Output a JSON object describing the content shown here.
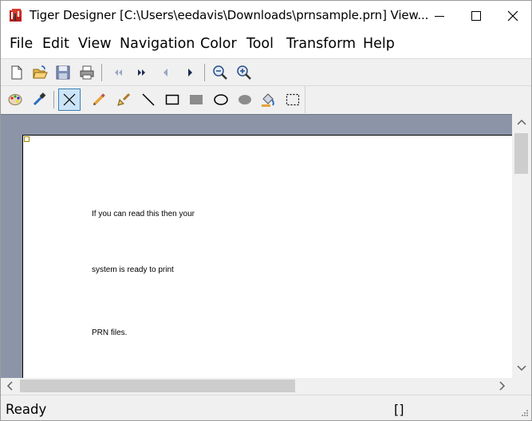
{
  "window": {
    "title": "Tiger Designer [C:\\Users\\eedavis\\Downloads\\prnsample.prn] View..."
  },
  "menu": {
    "items": [
      {
        "id": "file",
        "label": "File"
      },
      {
        "id": "edit",
        "label": "Edit"
      },
      {
        "id": "view",
        "label": "View"
      },
      {
        "id": "navigation",
        "label": "Navigation"
      },
      {
        "id": "color",
        "label": "Color"
      },
      {
        "id": "tool",
        "label": "Tool"
      },
      {
        "id": "transform",
        "label": "Transform"
      },
      {
        "id": "help",
        "label": "Help"
      }
    ]
  },
  "toolbar_main": {
    "buttons": [
      "new-document-icon",
      "open-folder-icon",
      "save-disk-icon",
      "print-icon",
      "first-page-icon",
      "last-page-icon",
      "previous-page-icon",
      "next-page-icon",
      "zoom-out-icon",
      "zoom-in-icon"
    ]
  },
  "toolbar_tools": {
    "buttons": [
      "color-palette-icon",
      "eyedropper-icon",
      "select-cross-icon",
      "pencil-icon",
      "brush-icon",
      "line-icon",
      "rectangle-icon",
      "filled-rectangle-icon",
      "ellipse-icon",
      "filled-ellipse-icon",
      "fill-bucket-icon",
      "marquee-select-icon"
    ],
    "active": "select-cross-icon"
  },
  "document": {
    "lines": [
      "If you can read this then your",
      "system is ready to print",
      "PRN files."
    ]
  },
  "status": {
    "text": "Ready",
    "indicator": "[]"
  },
  "colors": {
    "workspace": "#8c95a8",
    "active_tool_bg": "#cce4f7",
    "active_tool_border": "#3c7fb1"
  }
}
